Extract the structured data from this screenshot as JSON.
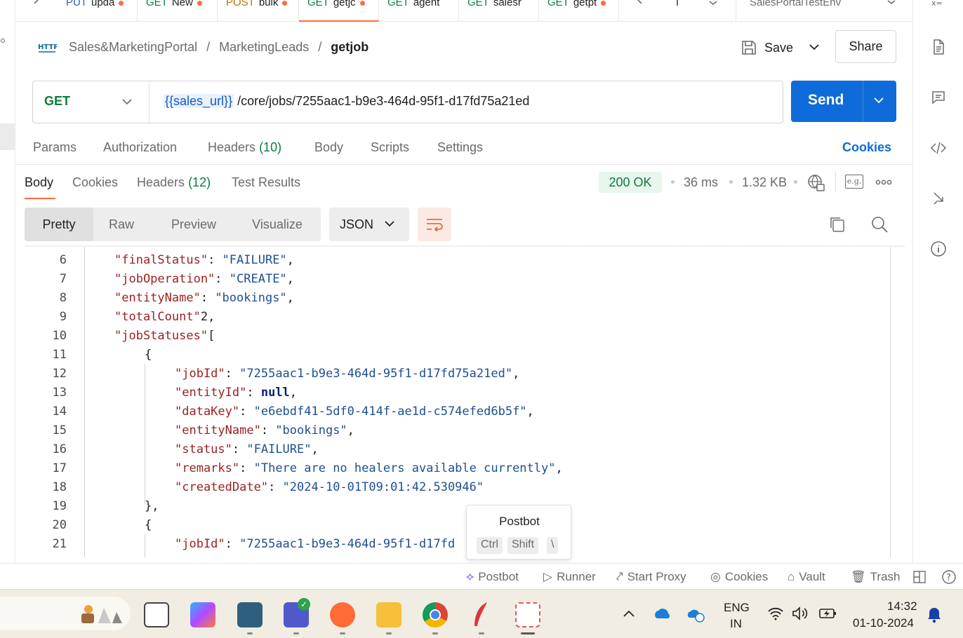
{
  "tabs": [
    {
      "method": "PUT",
      "name": "upda",
      "modified": true
    },
    {
      "method": "GET",
      "name": "New",
      "modified": true
    },
    {
      "method": "POST",
      "name": "bulk",
      "modified": true
    },
    {
      "method": "GET",
      "name": "getjc",
      "modified": true,
      "active": true
    },
    {
      "method": "GET",
      "name": "agent",
      "modified": false
    },
    {
      "method": "GET",
      "name": "salesr",
      "modified": false
    },
    {
      "method": "GET",
      "name": "getpt",
      "modified": true
    }
  ],
  "environment": "SalesPortalTestEnv",
  "breadcrumb": {
    "badge": "HTTP",
    "collection": "Sales&MarketingPortal",
    "sep1": "/",
    "folder": "MarketingLeads",
    "sep2": "/",
    "request": "getjob"
  },
  "actions": {
    "save": "Save",
    "share": "Share"
  },
  "request": {
    "method": "GET",
    "url_var": "{{sales_url}}",
    "url_path": "/core/jobs/7255aac1-b9e3-464d-95f1-d17fd75a21ed",
    "send": "Send"
  },
  "request_tabs": {
    "params": "Params",
    "authorization": "Authorization",
    "headers": "Headers",
    "headers_count": "(10)",
    "body": "Body",
    "scripts": "Scripts",
    "settings": "Settings",
    "cookies": "Cookies"
  },
  "response_tabs": {
    "body": "Body",
    "cookies": "Cookies",
    "headers": "Headers",
    "headers_count": "(12)",
    "tests": "Test Results"
  },
  "response_meta": {
    "status": "200 OK",
    "time": "36 ms",
    "size": "1.32 KB",
    "example_badge": "e.g."
  },
  "view": {
    "modes": [
      "Pretty",
      "Raw",
      "Preview",
      "Visualize"
    ],
    "format": "JSON"
  },
  "code_lines": [
    {
      "n": "6",
      "key": "finalStatus",
      "val": "\"FAILURE\"",
      "type": "s",
      "indent": 1,
      "comma": true
    },
    {
      "n": "7",
      "key": "jobOperation",
      "val": "\"CREATE\"",
      "type": "s",
      "indent": 1,
      "comma": true
    },
    {
      "n": "8",
      "key": "entityName",
      "val": "\"bookings\"",
      "type": "s",
      "indent": 1,
      "comma": true
    },
    {
      "n": "9",
      "key": "totalCount",
      "val": "2",
      "type": "p",
      "indent": 1,
      "comma": true
    },
    {
      "n": "10",
      "key": "jobStatuses",
      "val": "[",
      "type": "p",
      "indent": 1,
      "comma": false
    },
    {
      "n": "11",
      "key": "",
      "val": "{",
      "type": "p",
      "indent": 2,
      "comma": false
    },
    {
      "n": "12",
      "key": "jobId",
      "val": "\"7255aac1-b9e3-464d-95f1-d17fd75a21ed\"",
      "type": "s",
      "indent": 3,
      "comma": true
    },
    {
      "n": "13",
      "key": "entityId",
      "val": "null",
      "type": "nul",
      "indent": 3,
      "comma": true
    },
    {
      "n": "14",
      "key": "dataKey",
      "val": "\"e6ebdf41-5df0-414f-ae1d-c574efed6b5f\"",
      "type": "s",
      "indent": 3,
      "comma": true
    },
    {
      "n": "15",
      "key": "entityName",
      "val": "\"bookings\"",
      "type": "s",
      "indent": 3,
      "comma": true
    },
    {
      "n": "16",
      "key": "status",
      "val": "\"FAILURE\"",
      "type": "s",
      "indent": 3,
      "comma": true
    },
    {
      "n": "17",
      "key": "remarks",
      "val": "\"There are no healers available currently\"",
      "type": "s",
      "indent": 3,
      "comma": true
    },
    {
      "n": "18",
      "key": "createdDate",
      "val": "\"2024-10-01T09:01:42.530946\"",
      "type": "s",
      "indent": 3,
      "comma": false
    },
    {
      "n": "19",
      "key": "",
      "val": "},",
      "type": "p",
      "indent": 2,
      "comma": false
    },
    {
      "n": "20",
      "key": "",
      "val": "{",
      "type": "p",
      "indent": 2,
      "comma": false
    },
    {
      "n": "21",
      "key": "jobId",
      "val": "\"7255aac1-b9e3-464d-95f1-d17fd",
      "type": "s",
      "indent": 3,
      "comma": false
    }
  ],
  "postbot_popup": {
    "title": "Postbot",
    "keys": [
      "Ctrl",
      "Shift",
      "\\"
    ]
  },
  "statusbar": {
    "postbot": "Postbot",
    "runner": "Runner",
    "proxy": "Start Proxy",
    "cookies": "Cookies",
    "vault": "Vault",
    "trash": "Trash"
  },
  "tray": {
    "lang1": "ENG",
    "lang2": "IN",
    "time": "14:32",
    "date": "01-10-2024"
  },
  "colors": {
    "accent": "#ff6c37",
    "send": "#0f6bd9",
    "get": "#0b7d3e",
    "success_bg": "#e8f6ee"
  }
}
